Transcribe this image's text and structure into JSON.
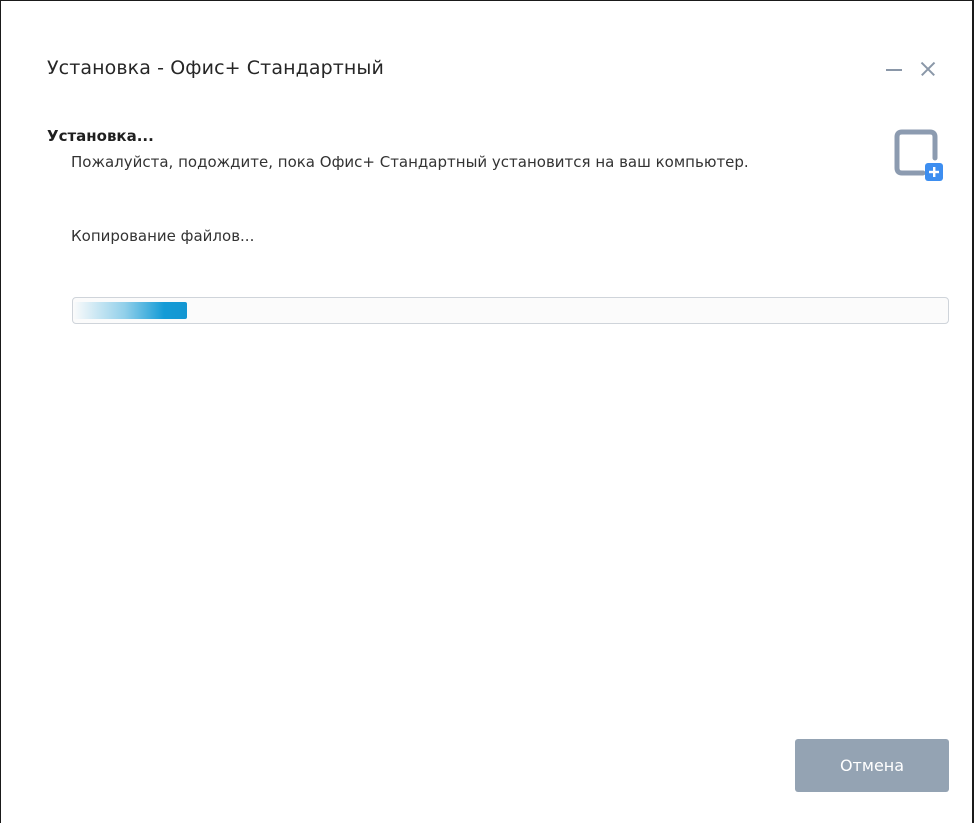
{
  "window": {
    "title": "Установка - Офис+ Стандартный",
    "controls": {
      "minimize": "minimize-icon",
      "close": "close-icon"
    }
  },
  "page": {
    "heading": "Установка...",
    "description": "Пожалуйста, подождите, пока Офис+ Стандартный установится на ваш компьютер.",
    "icon": "install-app-icon",
    "status_text": "Копирование файлов..."
  },
  "progress": {
    "percent": 13,
    "color": "#149bd6"
  },
  "buttons": {
    "cancel_label": "Отмена",
    "cancel_color": "#94a3b3"
  },
  "colors": {
    "icon_frame": "#8c9bb0",
    "icon_badge": "#3d8ef0"
  }
}
